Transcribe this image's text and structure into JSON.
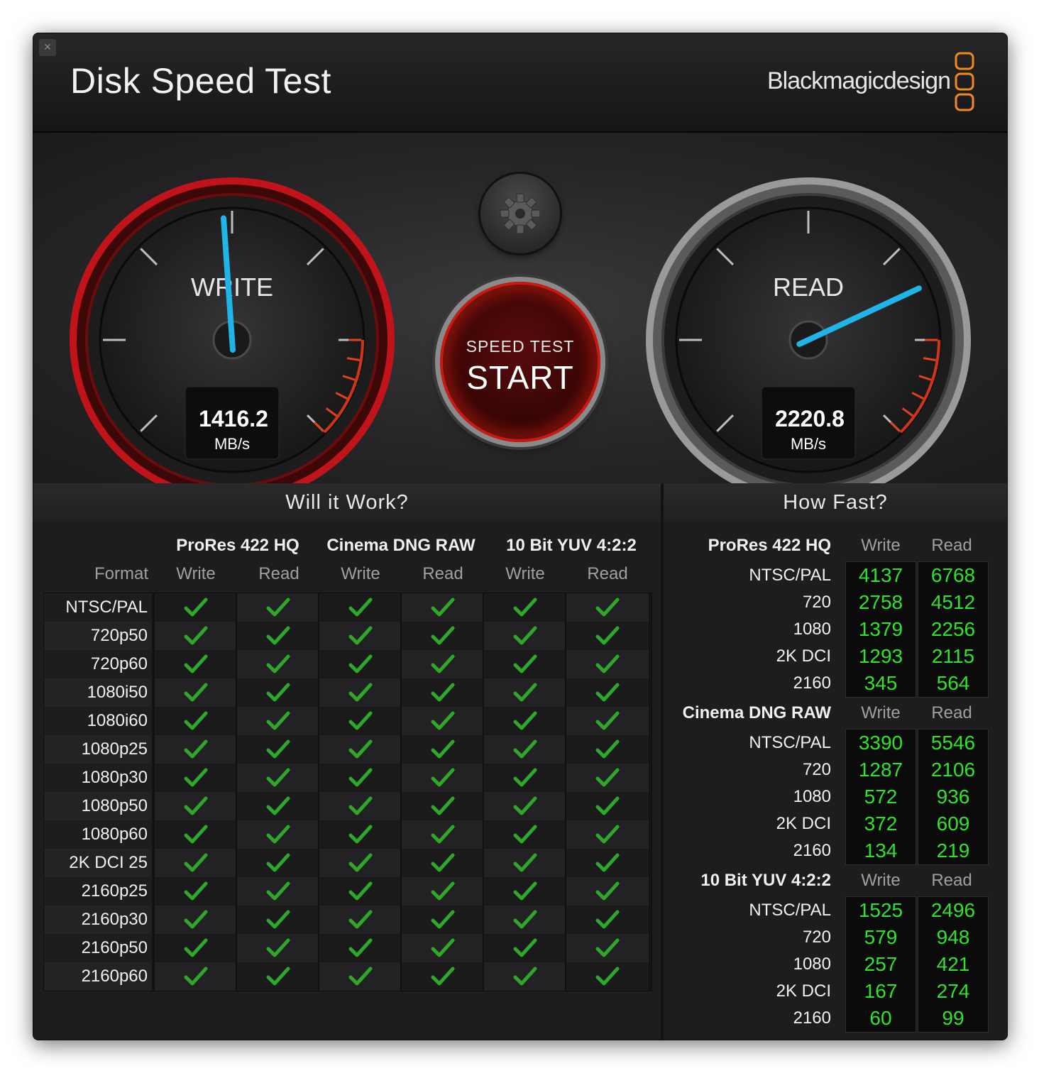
{
  "window": {
    "title": "Disk Speed Test",
    "brand": "Blackmagicdesign",
    "close_glyph": "×"
  },
  "gauges": {
    "write": {
      "label": "WRITE",
      "value": "1416.2",
      "unit": "MB/s",
      "ring_color": "#c0141a",
      "needle_color": "#1fb5e8"
    },
    "read": {
      "label": "READ",
      "value": "2220.8",
      "unit": "MB/s",
      "ring_color": "#9a9a9c",
      "needle_color": "#1fb5e8"
    }
  },
  "settings_button": {
    "icon": "gear-icon"
  },
  "start_button": {
    "top": "SPEED TEST",
    "main": "START"
  },
  "will_it_work": {
    "heading": "Will it Work?",
    "format_label": "Format",
    "groups": [
      "ProRes 422 HQ",
      "Cinema DNG RAW",
      "10 Bit YUV 4:2:2"
    ],
    "subcols": [
      "Write",
      "Read",
      "Write",
      "Read",
      "Write",
      "Read"
    ],
    "rows": [
      "NTSC/PAL",
      "720p50",
      "720p60",
      "1080i50",
      "1080i60",
      "1080p25",
      "1080p30",
      "1080p50",
      "1080p60",
      "2K DCI 25",
      "2160p25",
      "2160p30",
      "2160p50",
      "2160p60"
    ],
    "all_supported": true,
    "check_color": "#2fa82a"
  },
  "how_fast": {
    "heading": "How Fast?",
    "value_color": "#2fe22a",
    "sections": [
      {
        "name": "ProRes 422 HQ",
        "write_label": "Write",
        "read_label": "Read",
        "rows": [
          {
            "label": "NTSC/PAL",
            "write": "4137",
            "read": "6768"
          },
          {
            "label": "720",
            "write": "2758",
            "read": "4512"
          },
          {
            "label": "1080",
            "write": "1379",
            "read": "2256"
          },
          {
            "label": "2K DCI",
            "write": "1293",
            "read": "2115"
          },
          {
            "label": "2160",
            "write": "345",
            "read": "564"
          }
        ]
      },
      {
        "name": "Cinema DNG RAW",
        "write_label": "Write",
        "read_label": "Read",
        "rows": [
          {
            "label": "NTSC/PAL",
            "write": "3390",
            "read": "5546"
          },
          {
            "label": "720",
            "write": "1287",
            "read": "2106"
          },
          {
            "label": "1080",
            "write": "572",
            "read": "936"
          },
          {
            "label": "2K DCI",
            "write": "372",
            "read": "609"
          },
          {
            "label": "2160",
            "write": "134",
            "read": "219"
          }
        ]
      },
      {
        "name": "10 Bit YUV 4:2:2",
        "write_label": "Write",
        "read_label": "Read",
        "rows": [
          {
            "label": "NTSC/PAL",
            "write": "1525",
            "read": "2496"
          },
          {
            "label": "720",
            "write": "579",
            "read": "948"
          },
          {
            "label": "1080",
            "write": "257",
            "read": "421"
          },
          {
            "label": "2K DCI",
            "write": "167",
            "read": "274"
          },
          {
            "label": "2160",
            "write": "60",
            "read": "99"
          }
        ]
      }
    ]
  }
}
